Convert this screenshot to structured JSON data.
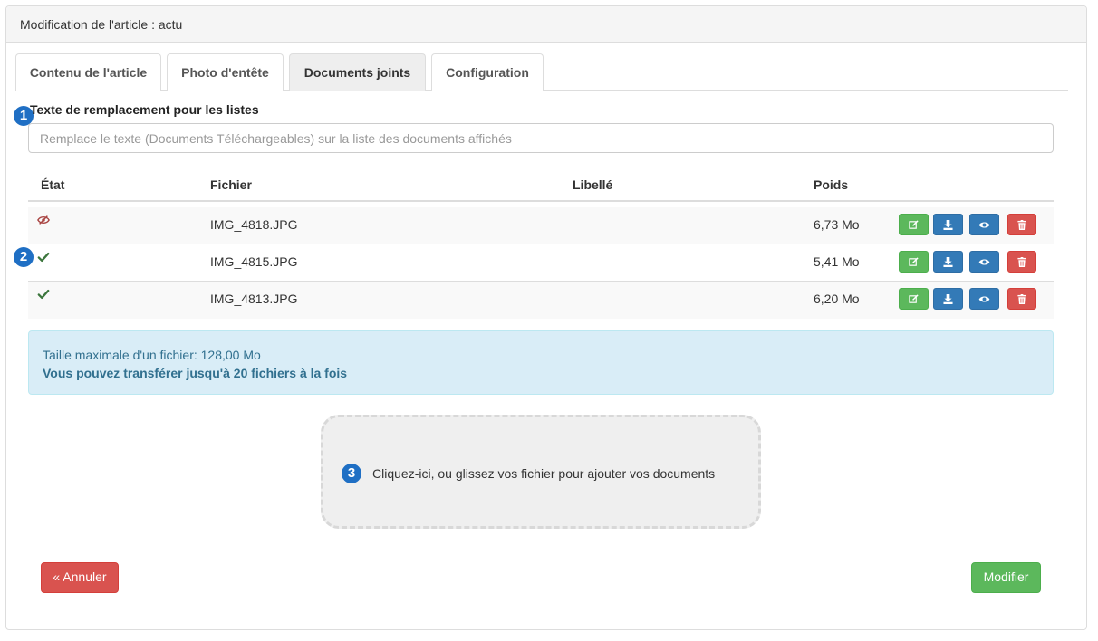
{
  "panel": {
    "title": "Modification de l'article : actu"
  },
  "tabs": [
    {
      "label": "Contenu de l'article",
      "active": false
    },
    {
      "label": "Photo d'entête",
      "active": false
    },
    {
      "label": "Documents joints",
      "active": true
    },
    {
      "label": "Configuration",
      "active": false
    }
  ],
  "markers": [
    "1",
    "2",
    "3"
  ],
  "replacement_field": {
    "label": "Texte de remplacement pour les listes",
    "placeholder": "Remplace le texte (Documents Téléchargeables) sur la liste des documents affichés",
    "value": ""
  },
  "table": {
    "headers": {
      "state": "État",
      "file": "Fichier",
      "label": "Libellé",
      "size": "Poids"
    },
    "rows": [
      {
        "state": "hidden",
        "state_icon": "eye-slash-icon",
        "file": "IMG_4818.JPG",
        "label": "",
        "size": "6,73 Mo"
      },
      {
        "state": "visible",
        "state_icon": "check-icon",
        "file": "IMG_4815.JPG",
        "label": "",
        "size": "5,41 Mo"
      },
      {
        "state": "visible",
        "state_icon": "check-icon",
        "file": "IMG_4813.JPG",
        "label": "",
        "size": "6,20 Mo"
      }
    ],
    "row_actions": [
      "edit-icon",
      "download-icon",
      "eye-icon",
      "trash-icon"
    ]
  },
  "info": {
    "max_size": "Taille maximale d'un fichier: 128,00 Mo",
    "max_files": "Vous pouvez transférer jusqu'à 20 fichiers à la fois"
  },
  "dropzone": {
    "text": "Cliquez-ici, ou glissez vos fichier pour ajouter vos documents"
  },
  "buttons": {
    "cancel": "« Annuler",
    "submit": "Modifier"
  },
  "colors": {
    "success": "#5cb85c",
    "primary": "#337ab7",
    "danger": "#d9534f",
    "info_bg": "#d9edf7",
    "info_text": "#31708f",
    "marker": "#1f6fc4"
  }
}
